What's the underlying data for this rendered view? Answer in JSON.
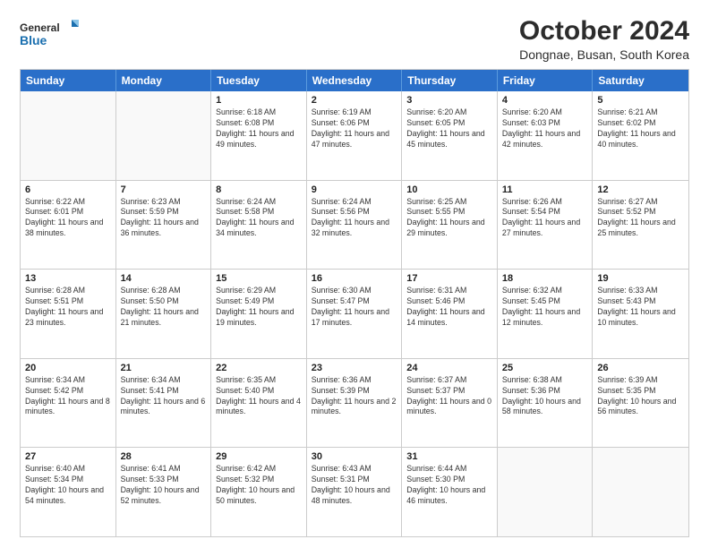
{
  "logo": {
    "text_general": "General",
    "text_blue": "Blue"
  },
  "title": "October 2024",
  "subtitle": "Dongnae, Busan, South Korea",
  "header_days": [
    "Sunday",
    "Monday",
    "Tuesday",
    "Wednesday",
    "Thursday",
    "Friday",
    "Saturday"
  ],
  "rows": [
    [
      {
        "day": "",
        "text": ""
      },
      {
        "day": "",
        "text": ""
      },
      {
        "day": "1",
        "text": "Sunrise: 6:18 AM\nSunset: 6:08 PM\nDaylight: 11 hours and 49 minutes."
      },
      {
        "day": "2",
        "text": "Sunrise: 6:19 AM\nSunset: 6:06 PM\nDaylight: 11 hours and 47 minutes."
      },
      {
        "day": "3",
        "text": "Sunrise: 6:20 AM\nSunset: 6:05 PM\nDaylight: 11 hours and 45 minutes."
      },
      {
        "day": "4",
        "text": "Sunrise: 6:20 AM\nSunset: 6:03 PM\nDaylight: 11 hours and 42 minutes."
      },
      {
        "day": "5",
        "text": "Sunrise: 6:21 AM\nSunset: 6:02 PM\nDaylight: 11 hours and 40 minutes."
      }
    ],
    [
      {
        "day": "6",
        "text": "Sunrise: 6:22 AM\nSunset: 6:01 PM\nDaylight: 11 hours and 38 minutes."
      },
      {
        "day": "7",
        "text": "Sunrise: 6:23 AM\nSunset: 5:59 PM\nDaylight: 11 hours and 36 minutes."
      },
      {
        "day": "8",
        "text": "Sunrise: 6:24 AM\nSunset: 5:58 PM\nDaylight: 11 hours and 34 minutes."
      },
      {
        "day": "9",
        "text": "Sunrise: 6:24 AM\nSunset: 5:56 PM\nDaylight: 11 hours and 32 minutes."
      },
      {
        "day": "10",
        "text": "Sunrise: 6:25 AM\nSunset: 5:55 PM\nDaylight: 11 hours and 29 minutes."
      },
      {
        "day": "11",
        "text": "Sunrise: 6:26 AM\nSunset: 5:54 PM\nDaylight: 11 hours and 27 minutes."
      },
      {
        "day": "12",
        "text": "Sunrise: 6:27 AM\nSunset: 5:52 PM\nDaylight: 11 hours and 25 minutes."
      }
    ],
    [
      {
        "day": "13",
        "text": "Sunrise: 6:28 AM\nSunset: 5:51 PM\nDaylight: 11 hours and 23 minutes."
      },
      {
        "day": "14",
        "text": "Sunrise: 6:28 AM\nSunset: 5:50 PM\nDaylight: 11 hours and 21 minutes."
      },
      {
        "day": "15",
        "text": "Sunrise: 6:29 AM\nSunset: 5:49 PM\nDaylight: 11 hours and 19 minutes."
      },
      {
        "day": "16",
        "text": "Sunrise: 6:30 AM\nSunset: 5:47 PM\nDaylight: 11 hours and 17 minutes."
      },
      {
        "day": "17",
        "text": "Sunrise: 6:31 AM\nSunset: 5:46 PM\nDaylight: 11 hours and 14 minutes."
      },
      {
        "day": "18",
        "text": "Sunrise: 6:32 AM\nSunset: 5:45 PM\nDaylight: 11 hours and 12 minutes."
      },
      {
        "day": "19",
        "text": "Sunrise: 6:33 AM\nSunset: 5:43 PM\nDaylight: 11 hours and 10 minutes."
      }
    ],
    [
      {
        "day": "20",
        "text": "Sunrise: 6:34 AM\nSunset: 5:42 PM\nDaylight: 11 hours and 8 minutes."
      },
      {
        "day": "21",
        "text": "Sunrise: 6:34 AM\nSunset: 5:41 PM\nDaylight: 11 hours and 6 minutes."
      },
      {
        "day": "22",
        "text": "Sunrise: 6:35 AM\nSunset: 5:40 PM\nDaylight: 11 hours and 4 minutes."
      },
      {
        "day": "23",
        "text": "Sunrise: 6:36 AM\nSunset: 5:39 PM\nDaylight: 11 hours and 2 minutes."
      },
      {
        "day": "24",
        "text": "Sunrise: 6:37 AM\nSunset: 5:37 PM\nDaylight: 11 hours and 0 minutes."
      },
      {
        "day": "25",
        "text": "Sunrise: 6:38 AM\nSunset: 5:36 PM\nDaylight: 10 hours and 58 minutes."
      },
      {
        "day": "26",
        "text": "Sunrise: 6:39 AM\nSunset: 5:35 PM\nDaylight: 10 hours and 56 minutes."
      }
    ],
    [
      {
        "day": "27",
        "text": "Sunrise: 6:40 AM\nSunset: 5:34 PM\nDaylight: 10 hours and 54 minutes."
      },
      {
        "day": "28",
        "text": "Sunrise: 6:41 AM\nSunset: 5:33 PM\nDaylight: 10 hours and 52 minutes."
      },
      {
        "day": "29",
        "text": "Sunrise: 6:42 AM\nSunset: 5:32 PM\nDaylight: 10 hours and 50 minutes."
      },
      {
        "day": "30",
        "text": "Sunrise: 6:43 AM\nSunset: 5:31 PM\nDaylight: 10 hours and 48 minutes."
      },
      {
        "day": "31",
        "text": "Sunrise: 6:44 AM\nSunset: 5:30 PM\nDaylight: 10 hours and 46 minutes."
      },
      {
        "day": "",
        "text": ""
      },
      {
        "day": "",
        "text": ""
      }
    ]
  ]
}
